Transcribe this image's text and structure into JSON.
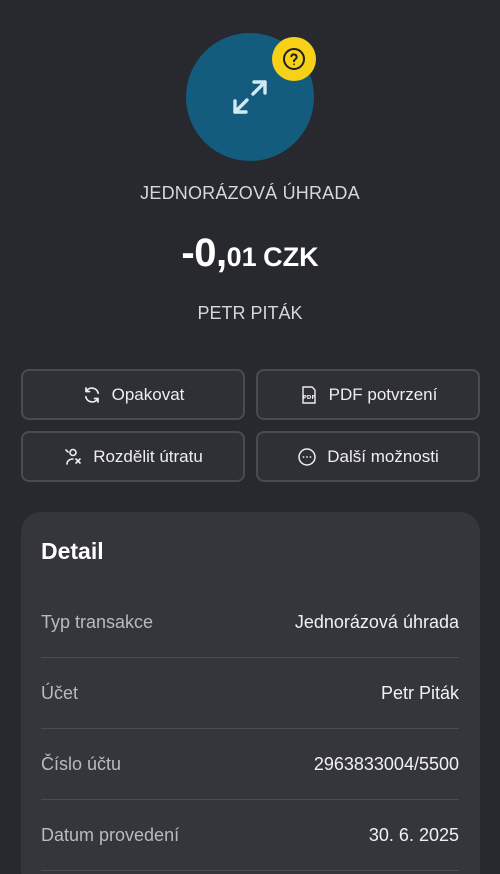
{
  "hero": {
    "icon": "transfer-arrows-icon",
    "badge_icon": "question-mark-icon",
    "transaction_type": "JEDNORÁZOVÁ ÚHRADA",
    "amount_main": "-0,",
    "amount_decimals": "01",
    "currency": "CZK",
    "counterparty": "PETR PITÁK"
  },
  "actions": {
    "repeat": {
      "label": "Opakovat",
      "icon": "refresh-icon"
    },
    "pdf": {
      "label": "PDF potvrzení",
      "icon": "pdf-icon"
    },
    "split": {
      "label": "Rozdělit útratu",
      "icon": "split-person-icon"
    },
    "more": {
      "label": "Další možnosti",
      "icon": "more-options-icon"
    }
  },
  "detail": {
    "title": "Detail",
    "rows": [
      {
        "label": "Typ transakce",
        "value": "Jednorázová úhrada"
      },
      {
        "label": "Účet",
        "value": "Petr Piták"
      },
      {
        "label": "Číslo účtu",
        "value": "2963833004/5500"
      },
      {
        "label": "Datum provedení",
        "value": "30. 6. 2025"
      }
    ]
  },
  "colors": {
    "background": "#28292e",
    "avatar": "#145c7e",
    "badge": "#f6d117",
    "card": "#35363b"
  }
}
